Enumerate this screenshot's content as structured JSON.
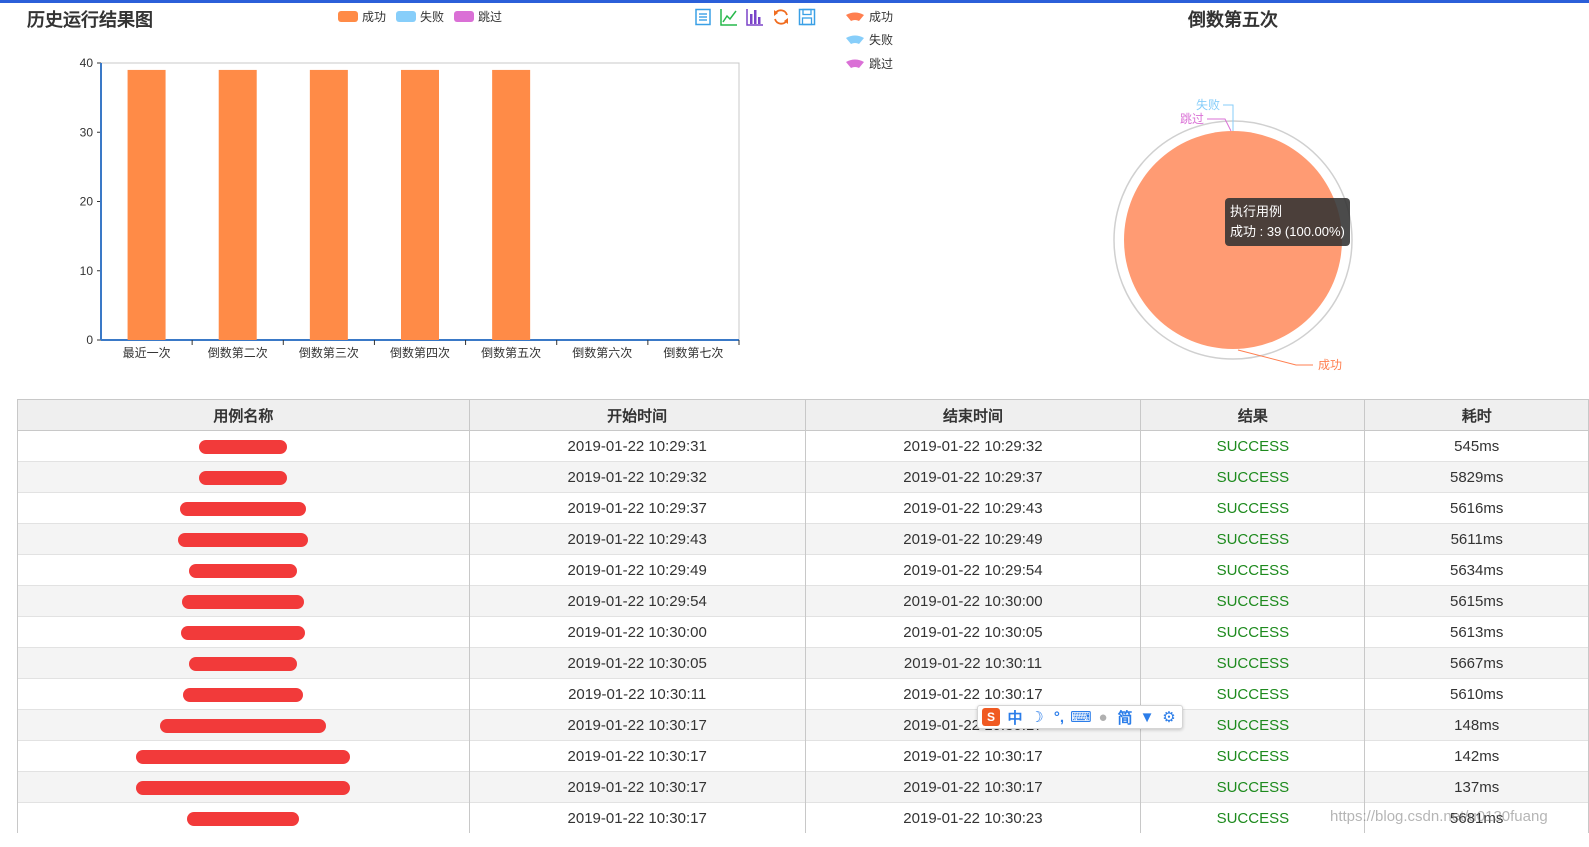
{
  "bar_panel": {
    "title": "历史运行结果图",
    "legend": [
      {
        "label": "成功",
        "color": "#ff8b47"
      },
      {
        "label": "失败",
        "color": "#87cefa"
      },
      {
        "label": "跳过",
        "color": "#da70d6"
      }
    ],
    "toolbox": [
      "data-view-icon",
      "line-chart-icon",
      "bar-chart-icon",
      "restore-icon",
      "save-image-icon"
    ]
  },
  "pie_panel": {
    "title": "倒数第五次",
    "legend": [
      {
        "label": "成功",
        "color": "#ff7f50"
      },
      {
        "label": "失败",
        "color": "#87cefa"
      },
      {
        "label": "跳过",
        "color": "#da70d6"
      }
    ],
    "tooltip": {
      "title": "执行用例",
      "line": "成功 : 39 (100.00%)"
    }
  },
  "chart_data": [
    {
      "type": "bar",
      "categories": [
        "最近一次",
        "倒数第二次",
        "倒数第三次",
        "倒数第四次",
        "倒数第五次",
        "倒数第六次",
        "倒数第七次"
      ],
      "series": [
        {
          "name": "成功",
          "values": [
            39,
            39,
            39,
            39,
            39,
            0,
            0
          ]
        },
        {
          "name": "失败",
          "values": [
            0,
            0,
            0,
            0,
            0,
            0,
            0
          ]
        },
        {
          "name": "跳过",
          "values": [
            0,
            0,
            0,
            0,
            0,
            0,
            0
          ]
        }
      ],
      "yticks": [
        0,
        10,
        20,
        30,
        40
      ],
      "ylim": [
        0,
        40
      ],
      "legend": "top"
    },
    {
      "type": "pie",
      "title": "倒数第五次",
      "labels": [
        "成功",
        "失败",
        "跳过"
      ],
      "values": [
        39,
        0,
        0
      ],
      "colors": [
        "#ff9b73",
        "#87cefa",
        "#da70d6"
      ]
    }
  ],
  "table": {
    "headers": [
      "用例名称",
      "开始时间",
      "结束时间",
      "结果",
      "耗时"
    ],
    "rows": [
      {
        "start": "2019-01-22 10:29:31",
        "end": "2019-01-22 10:29:32",
        "result": "SUCCESS",
        "time": "545ms"
      },
      {
        "start": "2019-01-22 10:29:32",
        "end": "2019-01-22 10:29:37",
        "result": "SUCCESS",
        "time": "5829ms"
      },
      {
        "start": "2019-01-22 10:29:37",
        "end": "2019-01-22 10:29:43",
        "result": "SUCCESS",
        "time": "5616ms"
      },
      {
        "start": "2019-01-22 10:29:43",
        "end": "2019-01-22 10:29:49",
        "result": "SUCCESS",
        "time": "5611ms"
      },
      {
        "start": "2019-01-22 10:29:49",
        "end": "2019-01-22 10:29:54",
        "result": "SUCCESS",
        "time": "5634ms"
      },
      {
        "start": "2019-01-22 10:29:54",
        "end": "2019-01-22 10:30:00",
        "result": "SUCCESS",
        "time": "5615ms"
      },
      {
        "start": "2019-01-22 10:30:00",
        "end": "2019-01-22 10:30:05",
        "result": "SUCCESS",
        "time": "5613ms"
      },
      {
        "start": "2019-01-22 10:30:05",
        "end": "2019-01-22 10:30:11",
        "result": "SUCCESS",
        "time": "5667ms"
      },
      {
        "start": "2019-01-22 10:30:11",
        "end": "2019-01-22 10:30:17",
        "result": "SUCCESS",
        "time": "5610ms"
      },
      {
        "start": "2019-01-22 10:30:17",
        "end": "2019-01-22 10:30:17",
        "result": "SUCCESS",
        "time": "148ms"
      },
      {
        "start": "2019-01-22 10:30:17",
        "end": "2019-01-22 10:30:17",
        "result": "SUCCESS",
        "time": "142ms"
      },
      {
        "start": "2019-01-22 10:30:17",
        "end": "2019-01-22 10:30:17",
        "result": "SUCCESS",
        "time": "137ms"
      },
      {
        "start": "2019-01-22 10:30:17",
        "end": "2019-01-22 10:30:23",
        "result": "SUCCESS",
        "time": "5681ms"
      }
    ]
  },
  "ime_bar": {
    "items": [
      "中",
      "简"
    ]
  },
  "watermark": "https://blog.csdn.net/u0130fuang"
}
